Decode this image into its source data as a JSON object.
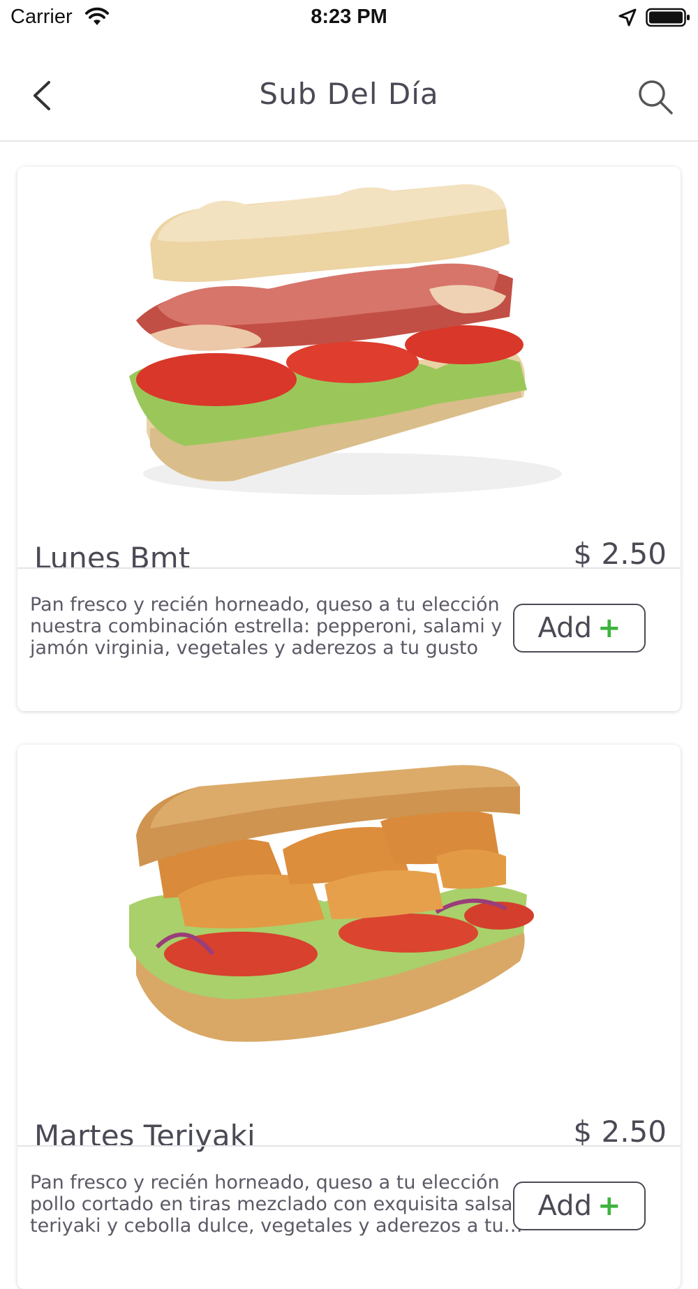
{
  "status_bar": {
    "carrier": "Carrier",
    "time": "8:23 PM"
  },
  "header": {
    "title": "Sub Del Día",
    "back_icon": "chevron-left-icon",
    "search_icon": "search-icon"
  },
  "products": [
    {
      "name": "Lunes Bmt",
      "price": "$ 2.50",
      "description": "Pan fresco y  recién horneado, queso a tu elección nuestra combinación estrella: pepperoni, salami y jamón virginia, vegetales y aderezos a tu gusto",
      "add_label": "Add",
      "add_icon": "plus-icon"
    },
    {
      "name": "Martes Teriyaki",
      "price": "$ 2.50",
      "description": "Pan fresco y  recién horneado, queso a tu elección pollo cortado en tiras mezclado con exquisita salsa teriyaki y cebolla dulce, vegetales y aderezos a tu…",
      "add_label": "Add",
      "add_icon": "plus-icon"
    }
  ],
  "colors": {
    "text": "#4a4a55",
    "accent_green": "#3db33d",
    "divider": "#e4e4e8"
  }
}
